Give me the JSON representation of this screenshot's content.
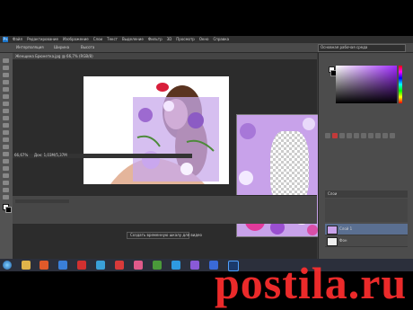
{
  "menu": {
    "logo": "Ps",
    "items": [
      "Файл",
      "Редактирование",
      "Изображение",
      "Слои",
      "Текст",
      "Выделение",
      "Фильтр",
      "3D",
      "Просмотр",
      "Окно",
      "Справка"
    ]
  },
  "options_bar": {
    "label1": "Интерполяция",
    "label2": "Ширина",
    "label3": "Высота"
  },
  "document": {
    "tab_title": "Женщина Брюнетка.jpg @ 66,7% (RGB/8)",
    "zoom": "66,67%",
    "doc_info": "Док: 1,03М/5,37М"
  },
  "timeline_tooltip": "Создать временную шкалу для видео",
  "panel": {
    "workspace": "Основная рабочая среда",
    "layers_label": "Слои",
    "layer1": "Слой 1",
    "layer2": "Фон"
  },
  "taskbar_icons": [
    "start",
    "explorer",
    "media",
    "files",
    "photoshop",
    "app",
    "browser",
    "app2",
    "app3",
    "skype",
    "app4",
    "app5",
    "ps-active"
  ],
  "watermark": "postila.ru",
  "colors": {
    "accent": "#a12cff",
    "watermark": "#ff2e2e"
  }
}
